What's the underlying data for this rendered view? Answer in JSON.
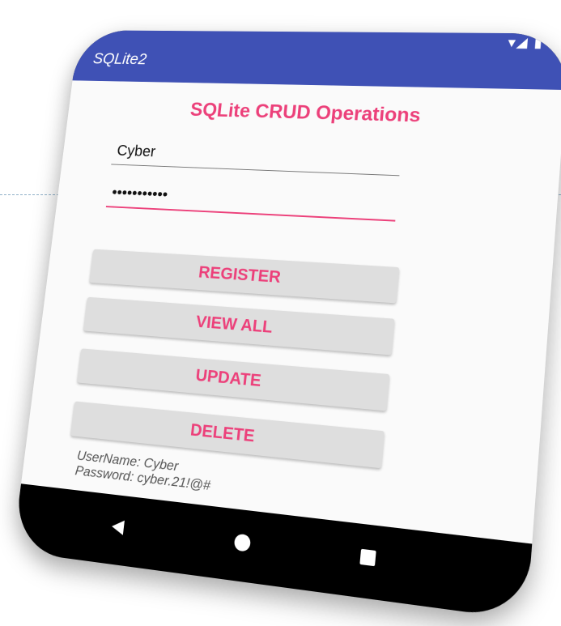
{
  "statusbar": {
    "icons": "▾◢ ▮ ▪"
  },
  "appbar": {
    "title": "SQLite2"
  },
  "form": {
    "heading": "SQLite CRUD Operations",
    "username_value": "Cyber",
    "password_value": "•••••••••••"
  },
  "buttons": {
    "register": "REGISTER",
    "view_all": "VIEW ALL",
    "update": "UPDATE",
    "delete": "DELETE"
  },
  "info": {
    "username_line": "UserName: Cyber",
    "password_line": "Password: cyber.21!@#"
  },
  "navbar": {
    "back_icon": "back-triangle",
    "home_icon": "home-circle",
    "recents_icon": "recents-square"
  },
  "colors": {
    "appbar": "#3f51b5",
    "accent": "#ec407a",
    "button_bg": "#dedede"
  }
}
